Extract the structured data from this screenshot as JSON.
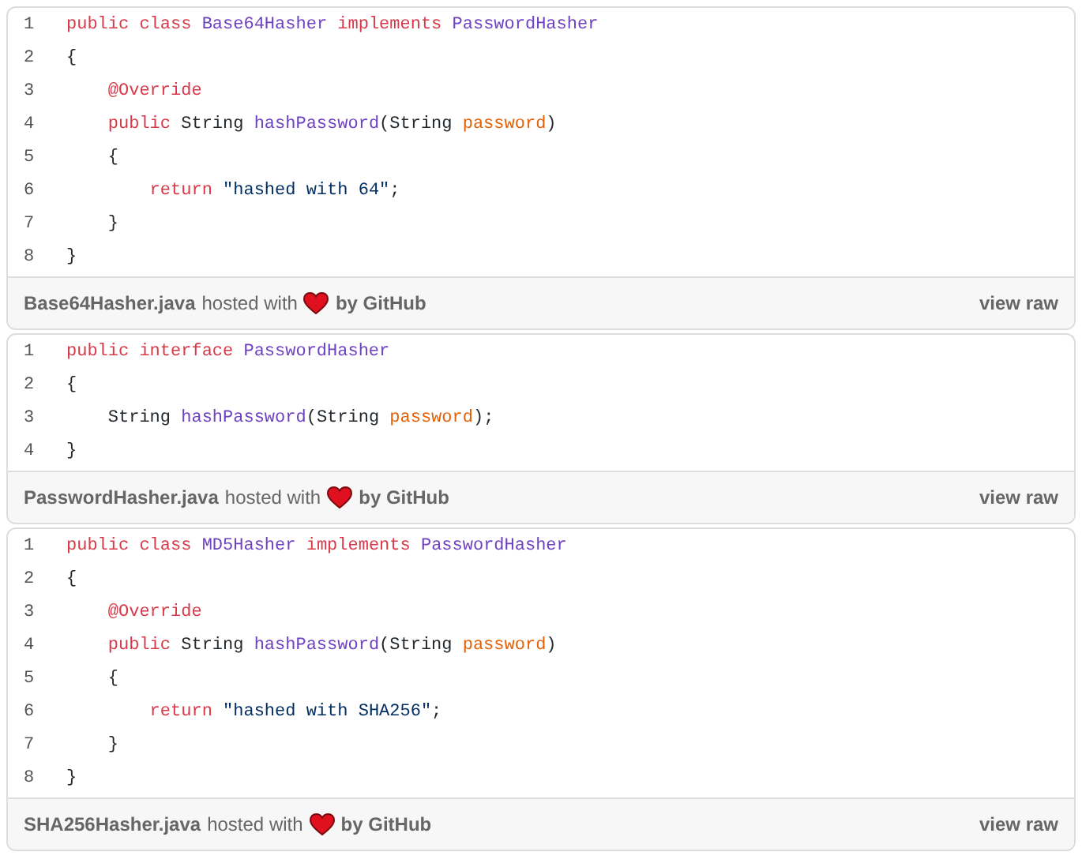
{
  "gists": [
    {
      "lines": [
        {
          "number": "1",
          "tokens": [
            {
              "kind": "keyword",
              "text": "public class "
            },
            {
              "kind": "entity",
              "text": "Base64Hasher"
            },
            {
              "kind": "keyword",
              "text": " implements "
            },
            {
              "kind": "entity",
              "text": "PasswordHasher"
            }
          ]
        },
        {
          "number": "2",
          "tokens": [
            {
              "kind": "plain",
              "text": "{"
            }
          ]
        },
        {
          "number": "3",
          "tokens": [
            {
              "kind": "keyword",
              "text": "    @Override"
            }
          ]
        },
        {
          "number": "4",
          "tokens": [
            {
              "kind": "keyword",
              "text": "    public"
            },
            {
              "kind": "plain",
              "text": " String "
            },
            {
              "kind": "entity",
              "text": "hashPassword"
            },
            {
              "kind": "plain",
              "text": "(String "
            },
            {
              "kind": "param",
              "text": "password"
            },
            {
              "kind": "plain",
              "text": ")"
            }
          ]
        },
        {
          "number": "5",
          "tokens": [
            {
              "kind": "plain",
              "text": "    {"
            }
          ]
        },
        {
          "number": "6",
          "tokens": [
            {
              "kind": "keyword",
              "text": "        return"
            },
            {
              "kind": "string",
              "text": " \"hashed with 64\""
            },
            {
              "kind": "plain",
              "text": ";"
            }
          ]
        },
        {
          "number": "7",
          "tokens": [
            {
              "kind": "plain",
              "text": "    }"
            }
          ]
        },
        {
          "number": "8",
          "tokens": [
            {
              "kind": "plain",
              "text": "}"
            }
          ]
        }
      ],
      "footer": {
        "file": "Base64Hasher.java",
        "hosted": "hosted with",
        "by": "by GitHub",
        "raw": "view raw"
      }
    },
    {
      "lines": [
        {
          "number": "1",
          "tokens": [
            {
              "kind": "keyword",
              "text": "public interface "
            },
            {
              "kind": "entity",
              "text": "PasswordHasher"
            }
          ]
        },
        {
          "number": "2",
          "tokens": [
            {
              "kind": "plain",
              "text": "{"
            }
          ]
        },
        {
          "number": "3",
          "tokens": [
            {
              "kind": "plain",
              "text": "    String "
            },
            {
              "kind": "entity",
              "text": "hashPassword"
            },
            {
              "kind": "plain",
              "text": "(String "
            },
            {
              "kind": "param",
              "text": "password"
            },
            {
              "kind": "plain",
              "text": ");"
            }
          ]
        },
        {
          "number": "4",
          "tokens": [
            {
              "kind": "plain",
              "text": "}"
            }
          ]
        }
      ],
      "footer": {
        "file": "PasswordHasher.java",
        "hosted": "hosted with",
        "by": "by GitHub",
        "raw": "view raw"
      }
    },
    {
      "lines": [
        {
          "number": "1",
          "tokens": [
            {
              "kind": "keyword",
              "text": "public class "
            },
            {
              "kind": "entity",
              "text": "MD5Hasher"
            },
            {
              "kind": "keyword",
              "text": " implements "
            },
            {
              "kind": "entity",
              "text": "PasswordHasher"
            }
          ]
        },
        {
          "number": "2",
          "tokens": [
            {
              "kind": "plain",
              "text": "{"
            }
          ]
        },
        {
          "number": "3",
          "tokens": [
            {
              "kind": "keyword",
              "text": "    @Override"
            }
          ]
        },
        {
          "number": "4",
          "tokens": [
            {
              "kind": "keyword",
              "text": "    public"
            },
            {
              "kind": "plain",
              "text": " String "
            },
            {
              "kind": "entity",
              "text": "hashPassword"
            },
            {
              "kind": "plain",
              "text": "(String "
            },
            {
              "kind": "param",
              "text": "password"
            },
            {
              "kind": "plain",
              "text": ")"
            }
          ]
        },
        {
          "number": "5",
          "tokens": [
            {
              "kind": "plain",
              "text": "    {"
            }
          ]
        },
        {
          "number": "6",
          "tokens": [
            {
              "kind": "keyword",
              "text": "        return"
            },
            {
              "kind": "string",
              "text": " \"hashed with SHA256\""
            },
            {
              "kind": "plain",
              "text": ";"
            }
          ]
        },
        {
          "number": "7",
          "tokens": [
            {
              "kind": "plain",
              "text": "    }"
            }
          ]
        },
        {
          "number": "8",
          "tokens": [
            {
              "kind": "plain",
              "text": "}"
            }
          ]
        }
      ],
      "footer": {
        "file": "SHA256Hasher.java",
        "hosted": "hosted with",
        "by": "by GitHub",
        "raw": "view raw"
      }
    }
  ]
}
